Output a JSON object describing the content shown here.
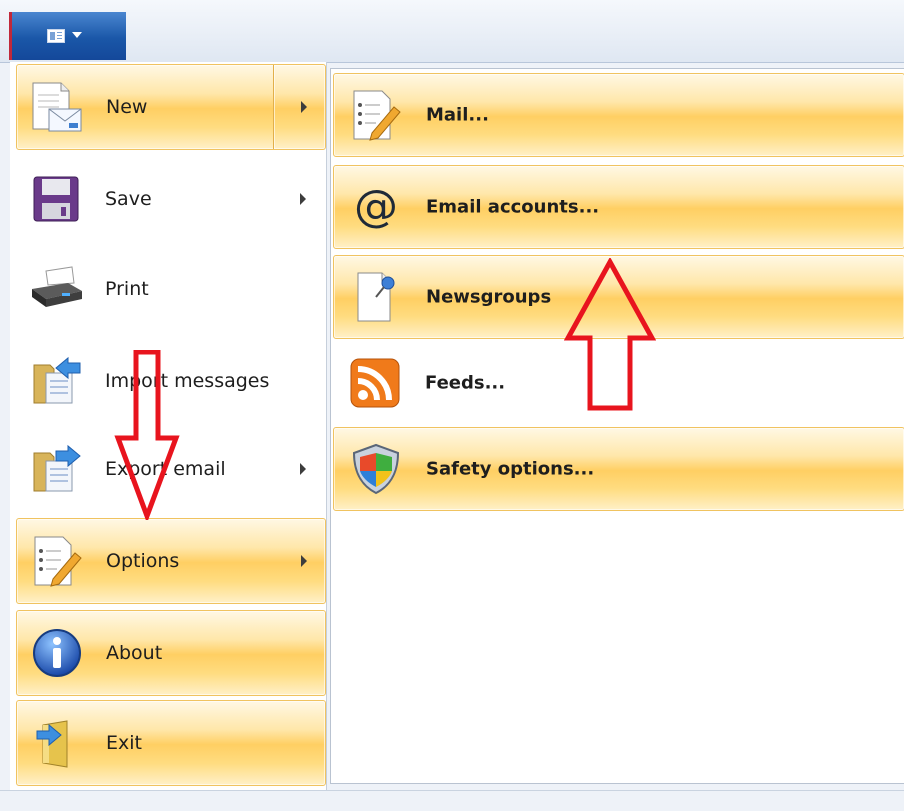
{
  "menu": {
    "left": [
      {
        "id": "new",
        "label": "New",
        "icon": "new-document-icon",
        "highlighted": true,
        "has_submenu": true
      },
      {
        "id": "save",
        "label": "Save",
        "icon": "floppy-disk-icon",
        "highlighted": false,
        "has_submenu": true
      },
      {
        "id": "print",
        "label": "Print",
        "icon": "printer-icon",
        "highlighted": false,
        "has_submenu": false
      },
      {
        "id": "import",
        "label": "Import messages",
        "icon": "import-folder-icon",
        "highlighted": false,
        "has_submenu": false
      },
      {
        "id": "export",
        "label": "Export email",
        "icon": "export-folder-icon",
        "highlighted": false,
        "has_submenu": true
      },
      {
        "id": "options",
        "label": "Options",
        "icon": "checklist-pencil-icon",
        "highlighted": true,
        "has_submenu": true
      },
      {
        "id": "about",
        "label": "About",
        "icon": "info-icon",
        "highlighted": true,
        "has_submenu": false
      },
      {
        "id": "exit",
        "label": "Exit",
        "icon": "exit-door-icon",
        "highlighted": true,
        "has_submenu": false
      }
    ],
    "right": [
      {
        "id": "mail",
        "label": "Mail...",
        "icon": "checklist-pencil-icon",
        "highlighted": true
      },
      {
        "id": "email_accounts",
        "label": "Email accounts...",
        "icon": "at-sign-icon",
        "highlighted": true
      },
      {
        "id": "newsgroups",
        "label": "Newsgroups",
        "icon": "newsgroup-pin-icon",
        "highlighted": true
      },
      {
        "id": "feeds",
        "label": "Feeds...",
        "icon": "rss-feed-icon",
        "highlighted": false
      },
      {
        "id": "safety",
        "label": "Safety options...",
        "icon": "security-shield-icon",
        "highlighted": true
      }
    ]
  },
  "annotations": [
    {
      "name": "annotation-arrow-down",
      "direction": "down",
      "color": "#e8141e"
    },
    {
      "name": "annotation-arrow-up",
      "direction": "up",
      "color": "#e8141e"
    }
  ]
}
